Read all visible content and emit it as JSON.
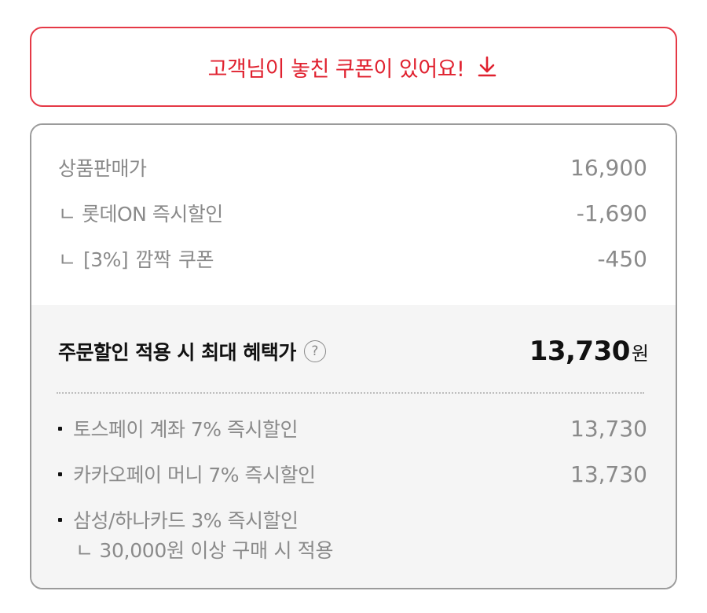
{
  "coupon_banner": {
    "text": "고객님이 놓친 쿠폰이 있어요!",
    "icon": "download-arrow-icon",
    "accent_color": "#e0212f"
  },
  "price_breakdown": {
    "product_price_label": "상품판매가",
    "product_price_value": "16,900",
    "lotteon_discount_label": "ㄴ 롯데ON 즉시할인",
    "lotteon_discount_value": "-1,690",
    "flash_coupon_label": "ㄴ [3%] 깜짝 쿠폰",
    "flash_coupon_value": "-450"
  },
  "total": {
    "label": "주문할인 적용 시 최대 혜택가",
    "help_icon_glyph": "?",
    "amount": "13,730",
    "unit": "원"
  },
  "benefits": [
    {
      "label": "토스페이 계좌 7% 즉시할인",
      "value": "13,730"
    },
    {
      "label": "카카오페이 머니 7% 즉시할인",
      "value": "13,730"
    },
    {
      "label": "삼성/하나카드 3% 즉시할인",
      "value": "",
      "note": "ㄴ 30,000원 이상 구매 시 적용"
    }
  ]
}
